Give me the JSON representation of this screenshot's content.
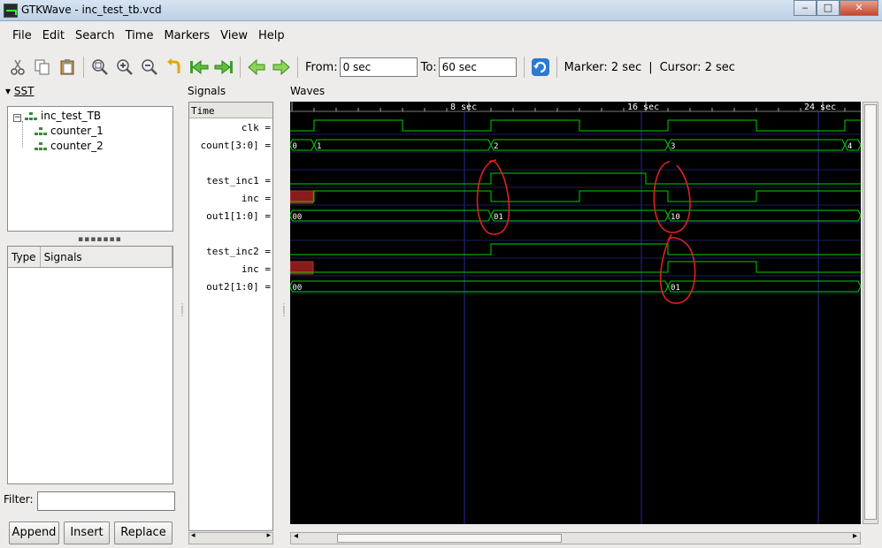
{
  "window": {
    "title": "GTKWave - inc_test_tb.vcd",
    "minimize": "‒",
    "maximize": "□",
    "close": "✕"
  },
  "menu": [
    "File",
    "Edit",
    "Search",
    "Time",
    "Markers",
    "View",
    "Help"
  ],
  "toolbar": {
    "from_label": "From:",
    "from_value": "0 sec",
    "to_label": "To:",
    "to_value": "60 sec",
    "marker_text": "Marker: 2 sec",
    "separator": "|",
    "cursor_text": "Cursor: 2 sec",
    "icons": [
      "cut-icon",
      "copy-icon",
      "paste-icon",
      "zoom-fit-icon",
      "zoom-in-icon",
      "zoom-out-icon",
      "undo-zoom-icon",
      "zoom-start-icon",
      "zoom-end-icon",
      "prev-page-icon",
      "next-page-icon",
      "reload-icon"
    ]
  },
  "sst": {
    "label": "SST",
    "tree": {
      "root": "inc_test_TB",
      "children": [
        "counter_1",
        "counter_2"
      ]
    },
    "columns": [
      "Type",
      "Signals"
    ],
    "filter_label": "Filter:",
    "buttons": [
      "Append",
      "Insert",
      "Replace"
    ]
  },
  "signals": {
    "label": "Signals",
    "header": "Time",
    "rows": [
      "clk =",
      "count[3:0] =",
      "",
      "test_inc1 =",
      "inc =",
      "out1[1:0] =",
      "",
      "test_inc2 =",
      "inc =",
      "out2[1:0] ="
    ]
  },
  "waves": {
    "label": "Waves",
    "colors": {
      "background": "#000000",
      "trace": "#00d000",
      "grid": "#2a2a9a",
      "text": "#ffffff",
      "highlight": "#8b1a1a",
      "annotation": "#e02020"
    },
    "time_ticks": [
      {
        "t": 8,
        "label": "8 sec"
      },
      {
        "t": 16,
        "label": "16 sec"
      },
      {
        "t": 24,
        "label": "24 sec"
      }
    ],
    "count_values": [
      "0",
      "1",
      "2",
      "3",
      "4"
    ],
    "out1_values": [
      "00",
      "01",
      "10"
    ],
    "out2_values": [
      "00",
      "01"
    ]
  }
}
